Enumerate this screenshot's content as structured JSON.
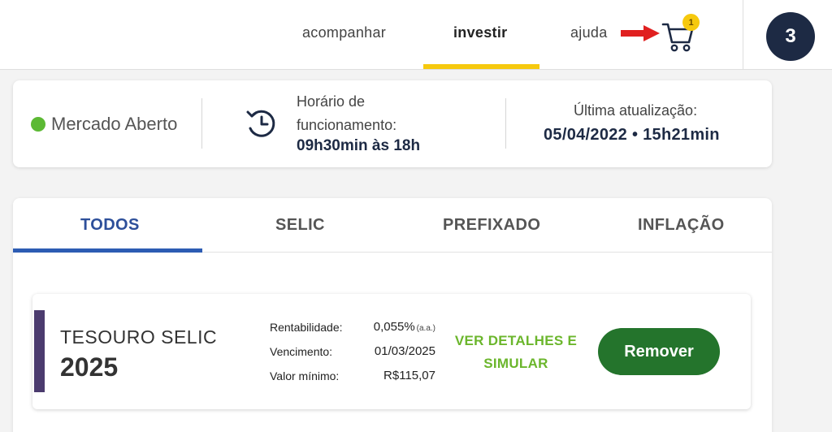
{
  "nav": {
    "links": [
      "acompanhar",
      "investir",
      "ajuda"
    ],
    "active_index": 1,
    "cart_badge": "1",
    "cart_icon": "shopping-cart-icon",
    "arrow_icon": "right-arrow-icon",
    "user_number": "3"
  },
  "status": {
    "market_label": "Mercado Aberto",
    "market_color": "#5cb934",
    "hours_label": "Horário de funcionamento:",
    "hours_value": "09h30min às 18h",
    "clock_icon": "clock-history-icon",
    "update_label": "Última atualização:",
    "update_value": "05/04/2022 • 15h21min"
  },
  "tabs": {
    "items": [
      "TODOS",
      "SELIC",
      "PREFIXADO",
      "INFLAÇÃO"
    ],
    "active_index": 0
  },
  "bond": {
    "name": "TESOURO SELIC",
    "year": "2025",
    "rows": [
      {
        "label": "Rentabilidade:",
        "value": "0,055%",
        "unit": "(a.a.)"
      },
      {
        "label": "Vencimento:",
        "value": "01/03/2025",
        "unit": ""
      },
      {
        "label": "Valor mínimo:",
        "value": "R$115,07",
        "unit": ""
      }
    ],
    "details_link": "VER DETALHES E SIMULAR",
    "remove_button": "Remover"
  },
  "colors": {
    "accent_yellow": "#f6c90e",
    "navy": "#1d2a44",
    "tab_blue": "#2d5cb3",
    "green_link": "#6bb62c",
    "remove_green": "#24742c",
    "stripe_purple": "#4b3b6e"
  }
}
